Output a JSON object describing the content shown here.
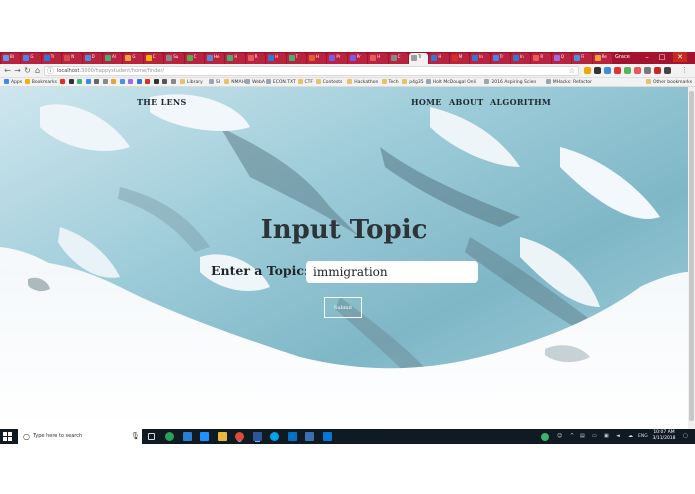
{
  "browser": {
    "tabs": [
      {
        "label": "Bl",
        "color": "#5a9be8"
      },
      {
        "label": "G",
        "color": "#4285f4"
      },
      {
        "label": "Tr",
        "color": "#2d7ad6"
      },
      {
        "label": "N",
        "color": "#d44c4c"
      },
      {
        "label": "D",
        "color": "#4a90e2"
      },
      {
        "label": "Al",
        "color": "#3cb371"
      },
      {
        "label": "G",
        "color": "#e8a33c"
      },
      {
        "label": "C",
        "color": "#f0b400"
      },
      {
        "label": "Su",
        "color": "#888888"
      },
      {
        "label": "C",
        "color": "#4caf50"
      },
      {
        "label": "He",
        "color": "#4a90e2"
      },
      {
        "label": "H",
        "color": "#3cb371"
      },
      {
        "label": "R",
        "color": "#e85c5c"
      },
      {
        "label": "H",
        "color": "#2d7ad6"
      },
      {
        "label": "T",
        "color": "#3cb371"
      },
      {
        "label": "H",
        "color": "#e06030"
      },
      {
        "label": "Pr",
        "color": "#7b5be6"
      },
      {
        "label": "Pr",
        "color": "#7b5be6"
      },
      {
        "label": "H",
        "color": "#e85c5c"
      },
      {
        "label": "C",
        "color": "#888888"
      },
      {
        "label": "Tr",
        "color": "#9c9c9c"
      },
      {
        "label": "H",
        "color": "#2d7ad6"
      },
      {
        "label": "M",
        "color": "#d93025"
      },
      {
        "label": "In",
        "color": "#2d7ad6"
      },
      {
        "label": "Tr",
        "color": "#4285f4"
      },
      {
        "label": "In",
        "color": "#2d7ad6"
      },
      {
        "label": "R",
        "color": "#e85c5c"
      },
      {
        "label": "Q",
        "color": "#9c6de8"
      },
      {
        "label": "Fi",
        "color": "#4a90e2"
      },
      {
        "label": "Re",
        "color": "#e8a33c"
      }
    ],
    "active_tab_index": 20,
    "profile_name": "Grace",
    "url_host": "localhost",
    "url_path": ":3000/happystudent/home/finder/",
    "bookmarks": [
      {
        "label": "Apps",
        "type": "apps"
      },
      {
        "label": "Bookmarks",
        "type": "star"
      },
      {
        "label": "Library",
        "type": "folder"
      },
      {
        "label": "SI",
        "type": "site"
      },
      {
        "label": "NMAH",
        "type": "folder"
      },
      {
        "label": "WebA",
        "type": "site"
      },
      {
        "label": "ECON.TXT",
        "type": "site"
      },
      {
        "label": "CTF",
        "type": "folder"
      },
      {
        "label": "Contests",
        "type": "folder"
      },
      {
        "label": "Hackathon",
        "type": "folder"
      },
      {
        "label": "Tech",
        "type": "folder"
      },
      {
        "label": "p4g35",
        "type": "folder"
      },
      {
        "label": "Holt McDougal Onli",
        "type": "site"
      },
      {
        "label": "2016 Aspiring Scien",
        "type": "site"
      },
      {
        "label": "MHacks: Refactor",
        "type": "site"
      },
      {
        "label": "Other bookmarks",
        "type": "folder"
      }
    ]
  },
  "site": {
    "brand": "THE LENS",
    "nav": [
      "HOME",
      "ABOUT",
      "ALGORITHM"
    ],
    "hero_title": "Input Topic",
    "topic_label": "Enter a Topic:",
    "topic_value": "immigration",
    "submit_label": "Submit"
  },
  "taskbar": {
    "search_placeholder": "Type here to search",
    "language": "ENG",
    "time": "10:07 AM",
    "date": "3/11/2018"
  },
  "colors": {
    "tabstrip": "#a3132d",
    "taskbar": "#101a22",
    "hero_text": "#2d3438"
  }
}
